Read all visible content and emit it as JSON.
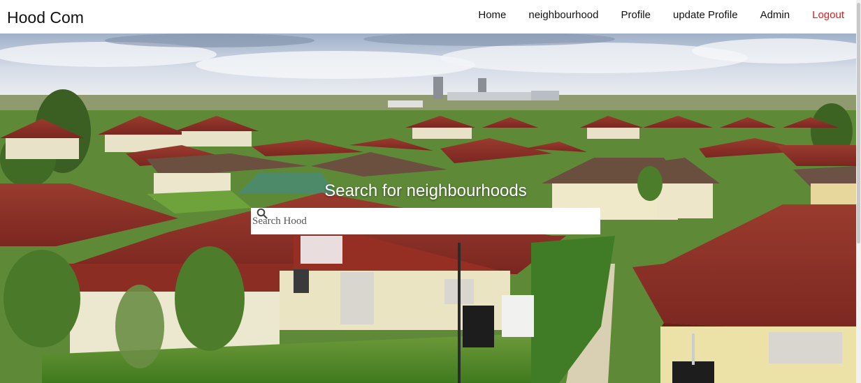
{
  "brand": "Hood Com",
  "nav": {
    "home": "Home",
    "neighbourhood": "neighbourhood",
    "profile": "Profile",
    "update_profile": "update Profile",
    "admin": "Admin",
    "logout": "Logout"
  },
  "hero": {
    "title": "Search for neighbourhoods",
    "search_placeholder": "Search Hood",
    "search_value": ""
  },
  "colors": {
    "logout": "#e01b1b",
    "roof": "#8e2f25",
    "sky": "#dfe6ef"
  }
}
